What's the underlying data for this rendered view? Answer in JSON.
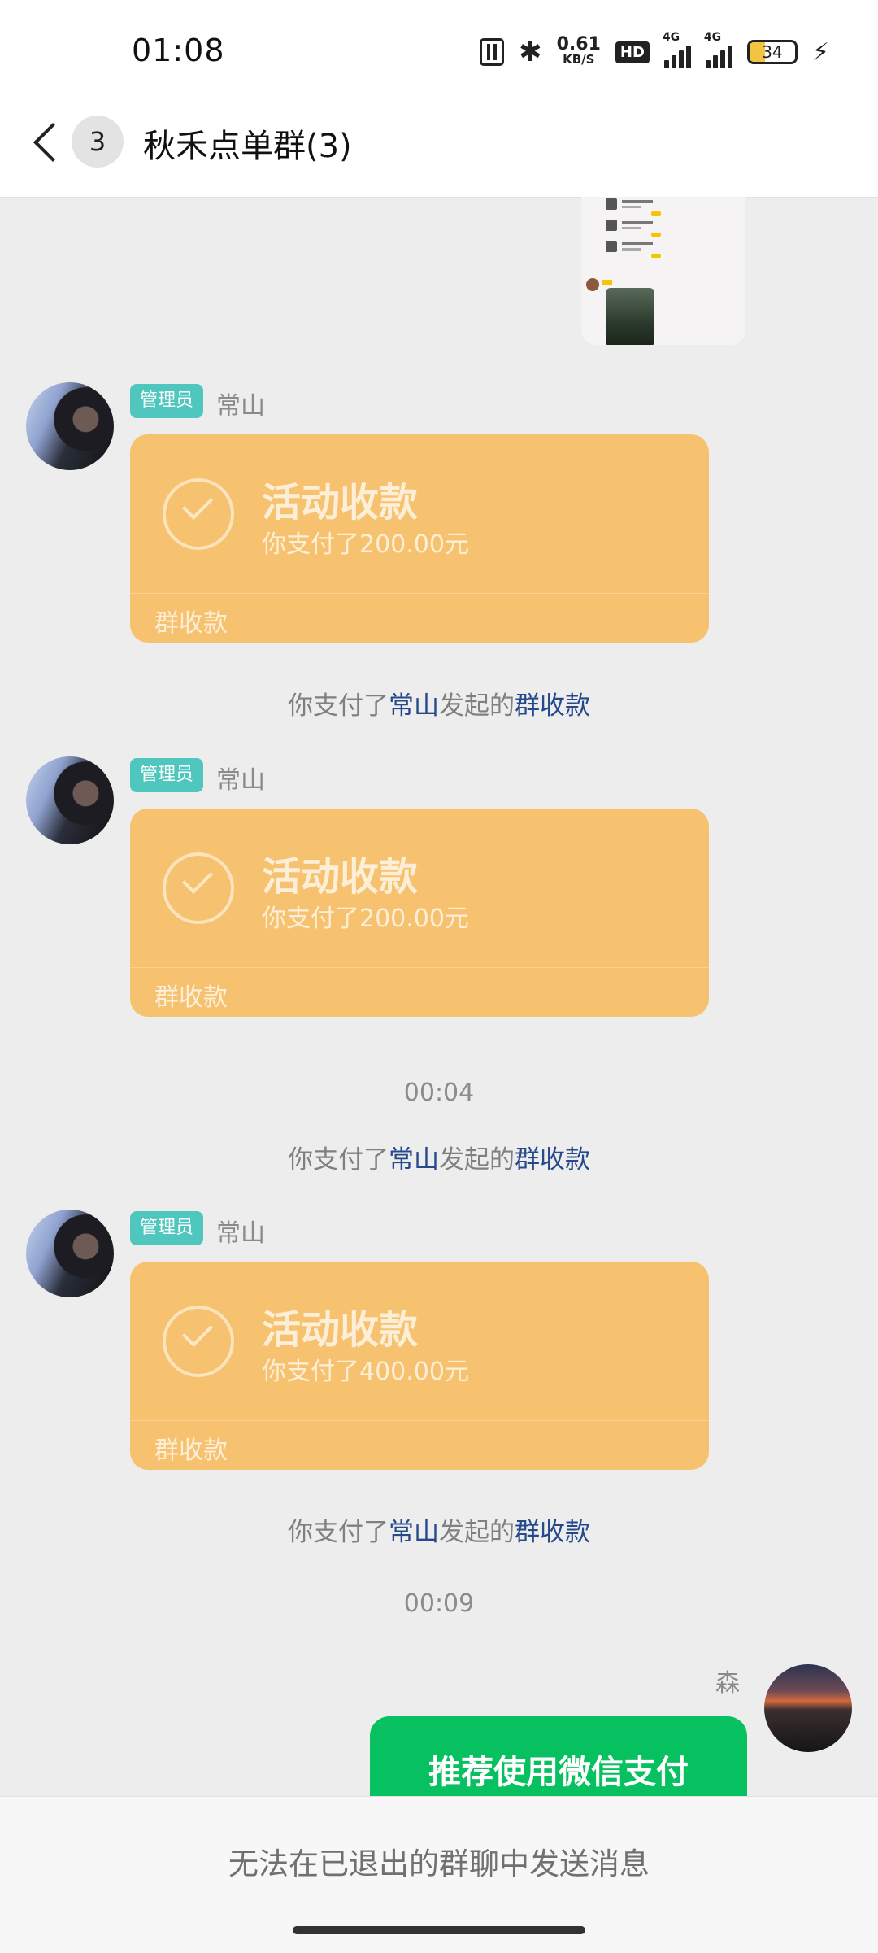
{
  "status_bar": {
    "time": "01:08",
    "net_speed_value": "0.61",
    "net_speed_unit": "KB/S",
    "hd_label": "HD",
    "sim1_label": "4G",
    "sim2_label": "4G",
    "battery": "34",
    "battery_level": 0.34
  },
  "header": {
    "unread_count": "3",
    "title": "秋禾点单群(3)"
  },
  "messages": [
    {
      "role_badge": "管理员",
      "sender": "常山",
      "card_title": "活动收款",
      "card_sub": "你支付了200.00元",
      "card_footer": "群收款"
    },
    {
      "role_badge": "管理员",
      "sender": "常山",
      "card_title": "活动收款",
      "card_sub": "你支付了200.00元",
      "card_footer": "群收款"
    },
    {
      "role_badge": "管理员",
      "sender": "常山",
      "card_title": "活动收款",
      "card_sub": "你支付了400.00元",
      "card_footer": "群收款"
    }
  ],
  "system": {
    "prefix": "你支付了",
    "name_link": "常山",
    "mid": "发起的",
    "action_link": "群收款"
  },
  "timestamps": [
    "00:04",
    "00:09"
  ],
  "own_message": {
    "sender": "森",
    "text": "推荐使用微信支付"
  },
  "footer": {
    "notice": "无法在已退出的群聊中发送消息"
  },
  "colors": {
    "accent_green": "#07C160",
    "card_orange": "#F7C26F",
    "admin_badge": "#4FC7BE",
    "link_blue": "#26498C"
  }
}
